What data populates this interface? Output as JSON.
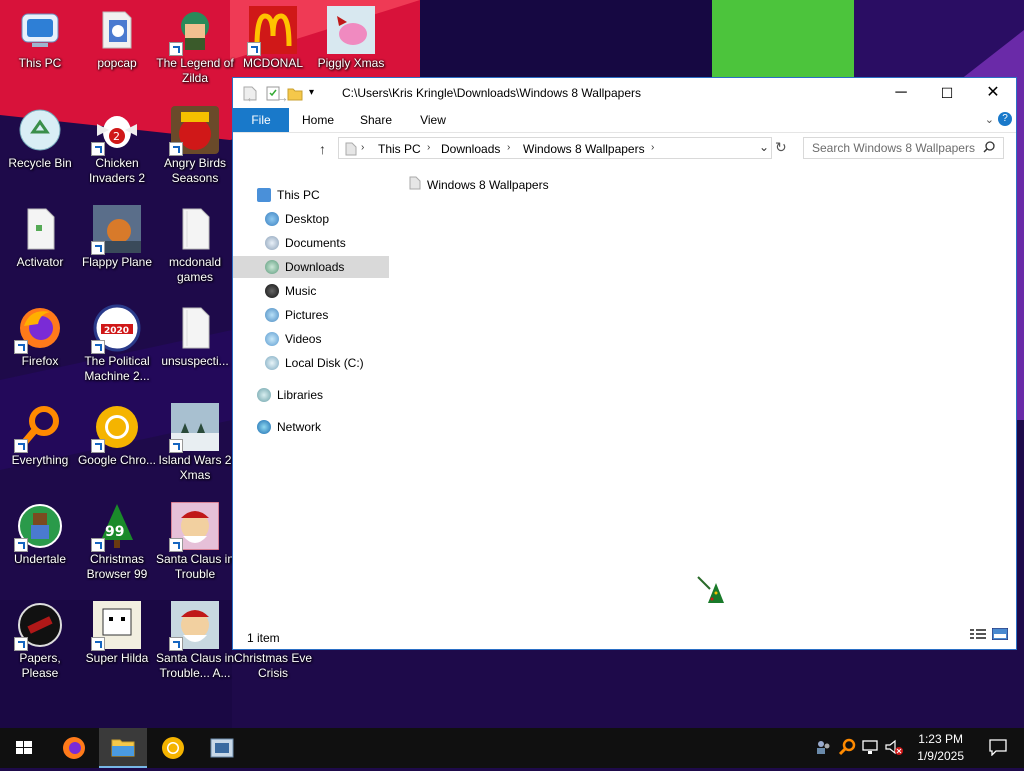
{
  "desktop_icons": [
    {
      "label": "This PC"
    },
    {
      "label": "popcap"
    },
    {
      "label": "The Legend of Zilda"
    },
    {
      "label": "MCDONAL"
    },
    {
      "label": "Piggly Xmas"
    },
    {
      "label": "Recycle Bin"
    },
    {
      "label": "Chicken Invaders 2"
    },
    {
      "label": "Angry Birds Seasons"
    },
    {
      "label": "Activator"
    },
    {
      "label": "Flappy Plane"
    },
    {
      "label": "mcdonald games"
    },
    {
      "label": "Firefox"
    },
    {
      "label": "The Political Machine 2..."
    },
    {
      "label": "unsuspecti..."
    },
    {
      "label": "Everything"
    },
    {
      "label": "Google Chro..."
    },
    {
      "label": "Island Wars 2 Xmas"
    },
    {
      "label": "Undertale"
    },
    {
      "label": "Christmas Browser 99"
    },
    {
      "label": "Santa Claus in Trouble"
    },
    {
      "label": "Papers, Please"
    },
    {
      "label": "Super Hilda"
    },
    {
      "label": "Santa Claus in Trouble... A..."
    },
    {
      "label": "Christmas Eve Crisis"
    }
  ],
  "explorer": {
    "title_path": "C:\\Users\\Kris Kringle\\Downloads\\Windows 8 Wallpapers",
    "ribbon_tabs": [
      "File",
      "Home",
      "Share",
      "View"
    ],
    "breadcrumbs": [
      "This PC",
      "Downloads",
      "Windows 8 Wallpapers"
    ],
    "search_placeholder": "Search Windows 8 Wallpapers",
    "nav": {
      "this_pc": "This PC",
      "items": [
        "Desktop",
        "Documents",
        "Downloads",
        "Music",
        "Pictures",
        "Videos",
        "Local Disk (C:)"
      ],
      "selected": "Downloads",
      "libraries": "Libraries",
      "network": "Network"
    },
    "files": [
      {
        "name": "Windows 8 Wallpapers",
        "icon": "folder-icon"
      }
    ],
    "status": "1 item"
  },
  "taskbar": {
    "time": "1:23 PM",
    "date": "1/9/2025"
  },
  "colors": {
    "accent": "#1979ca",
    "wallpaper_base": "#1e0a4a",
    "wallpaper_red": "#d8123a",
    "wallpaper_green": "#4cc43c",
    "wallpaper_violet": "#6a2aa8"
  }
}
